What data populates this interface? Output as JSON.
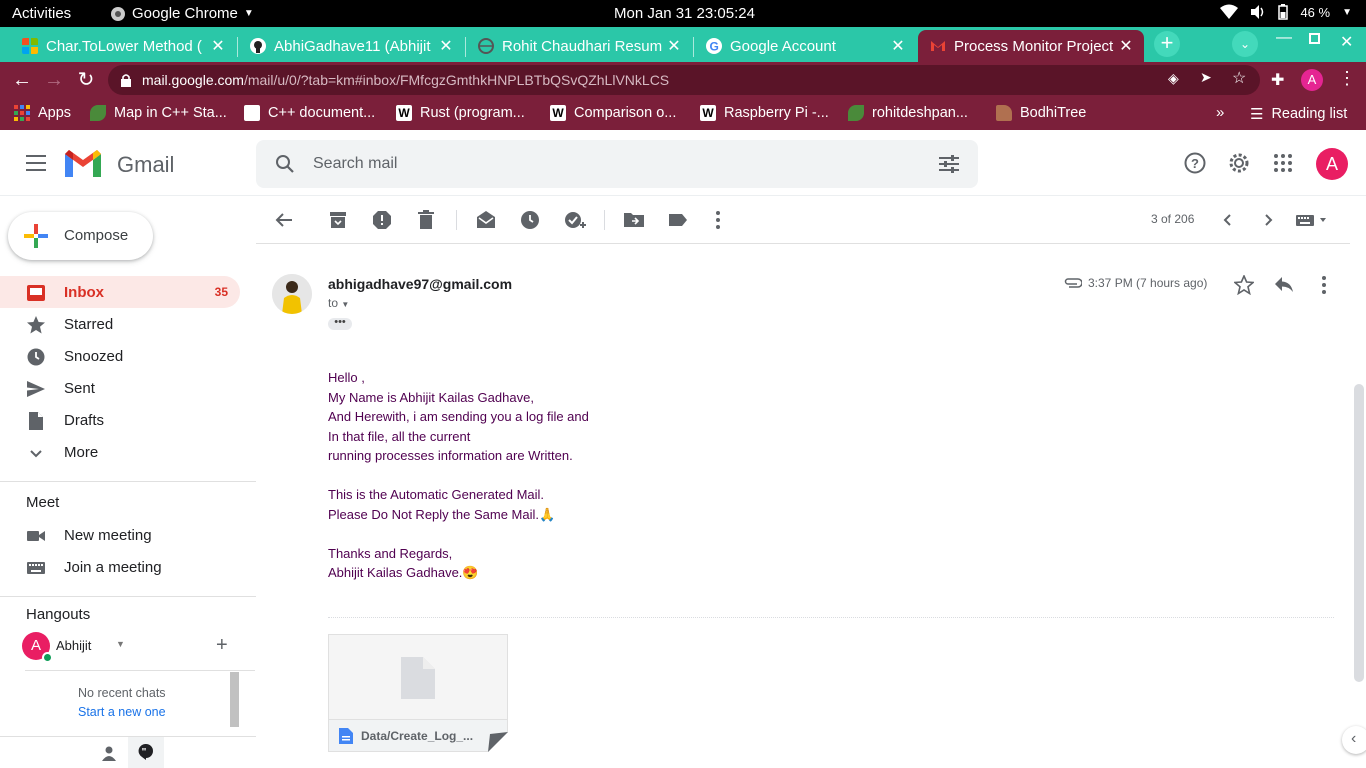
{
  "system": {
    "activities": "Activities",
    "app_name": "Google Chrome",
    "clock": "Mon Jan 31  23:05:24",
    "battery": "46 %"
  },
  "tabs": [
    {
      "title": "Char.ToLower Method (",
      "favicon": "windows-logo-icon"
    },
    {
      "title": "AbhiGadhave11 (Abhijit",
      "favicon": "github-icon"
    },
    {
      "title": "Rohit Chaudhari Resum",
      "favicon": "globe-icon"
    },
    {
      "title": "Google Account",
      "favicon": "google-icon"
    },
    {
      "title": "Process Monitor Project",
      "favicon": "gmail-icon",
      "active": true
    }
  ],
  "omnibox": {
    "host": "mail.google.com",
    "path": "/mail/u/0/?tab=km#inbox/FMfcgzGmthkHNPLBTbQSvQZhLlVNkLCS"
  },
  "profile_initial": "A",
  "bookmarks": [
    {
      "label": "Apps",
      "icon": "apps-grid-icon"
    },
    {
      "label": "Map in C++ Sta...",
      "icon": "leaf-icon"
    },
    {
      "label": "C++ document...",
      "icon": "search-doc-icon"
    },
    {
      "label": "Rust (program...",
      "icon": "wikipedia-icon"
    },
    {
      "label": "Comparison o...",
      "icon": "wikipedia-icon"
    },
    {
      "label": "Raspberry Pi -...",
      "icon": "wikipedia-icon"
    },
    {
      "label": "rohitdeshpan...",
      "icon": "leaf-icon"
    },
    {
      "label": "BodhiTree",
      "icon": "hat-icon"
    }
  ],
  "reading_list": "Reading list",
  "gmail": {
    "logo_text": "Gmail",
    "search_placeholder": "Search mail",
    "account_initial": "A",
    "compose": "Compose",
    "nav": [
      {
        "label": "Inbox",
        "count": "35",
        "icon": "inbox-icon",
        "active": true
      },
      {
        "label": "Starred",
        "icon": "star-icon"
      },
      {
        "label": "Snoozed",
        "icon": "clock-icon"
      },
      {
        "label": "Sent",
        "icon": "send-icon"
      },
      {
        "label": "Drafts",
        "icon": "draft-icon"
      },
      {
        "label": "More",
        "icon": "chevron-down-icon"
      }
    ],
    "meet": {
      "title": "Meet",
      "items": [
        {
          "label": "New meeting",
          "icon": "video-icon"
        },
        {
          "label": "Join a meeting",
          "icon": "keyboard-icon"
        }
      ]
    },
    "hangouts": {
      "title": "Hangouts",
      "user": "Abhijit",
      "user_initial": "A",
      "no_chats": "No recent chats",
      "start_new": "Start a new one"
    },
    "pager": "3 of 206",
    "message": {
      "from": "abhigadhave97@gmail.com",
      "to": "to",
      "time": "3:37 PM (7 hours ago)",
      "body": [
        [
          "Hello ,",
          "My Name is Abhijit Kailas Gadhave,",
          "And Herewith, i am sending you a log file and",
          "In that file, all the current",
          "running processes information are Written."
        ],
        [
          "This is the Automatic Generated Mail.",
          "Please Do Not Reply the Same Mail.🙏"
        ],
        [
          "Thanks and Regards,",
          "Abhijit Kailas Gadhave.😍"
        ]
      ],
      "attachment_name": "Data/Create_Log_..."
    }
  },
  "colors": {
    "tabstrip": "#2bc7a8",
    "toolbar": "#7b1f3a",
    "gmail_red": "#d93025",
    "body_text": "#500050"
  }
}
